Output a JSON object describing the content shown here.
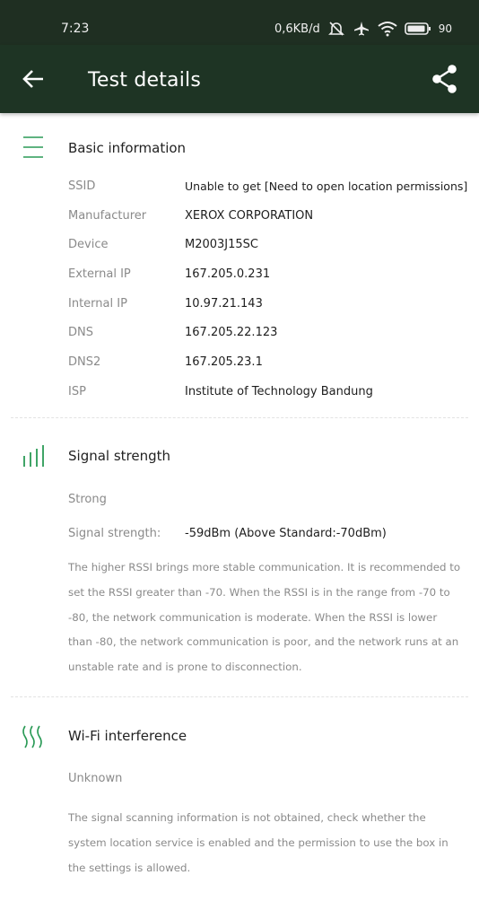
{
  "status_bar": {
    "time": "7:23",
    "net_speed": "0,6KB/d",
    "battery": "90"
  },
  "app_bar": {
    "title": "Test details",
    "back_icon": "arrow-left-icon",
    "share_icon": "share-icon"
  },
  "basic": {
    "title": "Basic information",
    "icon": "menu-lines-icon",
    "rows": [
      {
        "key": "SSID",
        "value": "Unable to get [Need to open location permissions]"
      },
      {
        "key": "Manufacturer",
        "value": "XEROX CORPORATION"
      },
      {
        "key": "Device",
        "value": "M2003J15SC"
      },
      {
        "key": "External IP",
        "value": "167.205.0.231"
      },
      {
        "key": "Internal IP",
        "value": "10.97.21.143"
      },
      {
        "key": "DNS",
        "value": "167.205.22.123"
      },
      {
        "key": "DNS2",
        "value": "167.205.23.1"
      },
      {
        "key": "ISP",
        "value": "Institute of Technology Bandung"
      }
    ]
  },
  "signal": {
    "title": "Signal strength",
    "icon": "signal-bars-icon",
    "status": "Strong",
    "label": "Signal strength:",
    "value": "-59dBm  (Above Standard:-70dBm)",
    "description": "The higher RSSI brings more stable communication. It is recommended to set the RSSI greater than -70. When the RSSI is in the range from -70 to -80, the network communication is moderate. When the RSSI is lower than -80, the network communication is poor, and the network runs at an unstable rate and is prone to disconnection."
  },
  "interference": {
    "title": "Wi-Fi interference",
    "icon": "wave-icon",
    "status": "Unknown",
    "description": "The signal scanning information is not obtained, check whether the system location service is enabled and the permission to use the box in the settings is allowed."
  },
  "colors": {
    "accent_green": "#2a9a56",
    "bar": "#1e3424",
    "status_bar": "#1f2f22"
  }
}
